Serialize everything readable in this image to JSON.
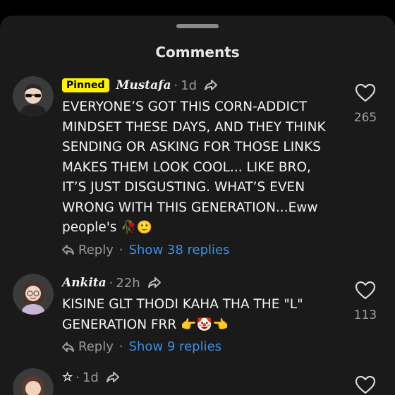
{
  "header": {
    "title": "Comments"
  },
  "comments": [
    {
      "pinned_label": "Pinned",
      "username": "Mustafa",
      "time": "1d",
      "text": "EVERYONE’S GOT THIS CORN-ADDICT\nMINDSET THESE DAYS, AND THEY THINK\nSENDING OR ASKING FOR THOSE LINKS\nMAKES THEM LOOK COOL... LIKE BRO,\nIT’S JUST DISGUSTING. WHAT’S EVEN\nWRONG WITH THIS GENERATION...Eww\npeople's",
      "text_emoji": "🥀🙂",
      "reply_label": "Reply",
      "show_replies": "Show 38 replies",
      "likes": "265"
    },
    {
      "username": "Ankita",
      "time": "22h",
      "text": "KISINE GLT THODI KAHA THA THE \"L\"\nGENERATION FRR",
      "text_emoji": "👉🤡👈",
      "reply_label": "Reply",
      "show_replies": "Show 9 replies",
      "likes": "113"
    },
    {
      "username": "☆",
      "time": "1d",
      "text": "",
      "text_emoji": ""
    }
  ],
  "icons": {
    "like": "heart-outline-icon",
    "share": "share-arrow-icon",
    "reply": "reply-arrow-icon"
  },
  "colors": {
    "pinned_badge": "#fff200",
    "link": "#3a8fe8",
    "background": "#1a1a1a"
  }
}
